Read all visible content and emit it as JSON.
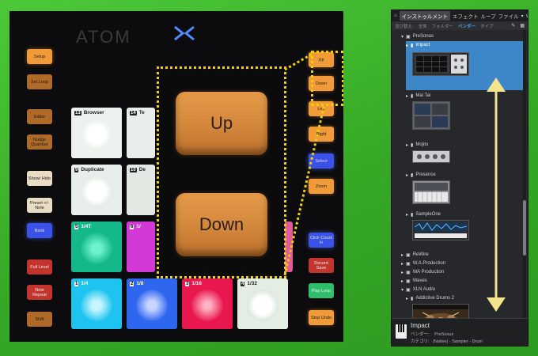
{
  "controller": {
    "logo_text": "ATOM",
    "left_buttons": [
      "Setup",
      "Set Loop",
      "Editor",
      "Nudge Quantize",
      "Show/ Hide",
      "Preset +/- Note",
      "Bank",
      "Full Level",
      "Note Repeat",
      "Shift"
    ],
    "right_buttons": [
      "Up",
      "Down",
      "Left",
      "Right",
      "Select",
      "Zoom",
      "Click Count In",
      "Record Save",
      "Play Loop",
      "Stop Undo"
    ],
    "pads": [
      {
        "num": "13",
        "label": "Browser"
      },
      {
        "num": "14",
        "label": "Te"
      },
      {
        "num": "9",
        "label": "Duplicate"
      },
      {
        "num": "10",
        "label": "De"
      },
      {
        "num": "5",
        "label": "1/4T"
      },
      {
        "num": "6",
        "label": "1/"
      },
      {
        "num": "1",
        "label": "1/4"
      },
      {
        "num": "2",
        "label": "1/8"
      },
      {
        "num": "3",
        "label": "1/16"
      },
      {
        "num": "4",
        "label": "1/32"
      }
    ],
    "zoom_keys": {
      "up": "Up",
      "down": "Down"
    }
  },
  "browser": {
    "tabs": [
      "インストゥルメント",
      "エフェクト",
      "ループ",
      "ファイル"
    ],
    "sort_label": "並び替え:",
    "sort_options": [
      "全体",
      "フォルダー",
      "ベンダー",
      "タイプ"
    ],
    "sort_selected": "ベンダー",
    "vendor": "PreSonus",
    "instruments": [
      "Impact",
      "Mai Tai",
      "Mojito",
      "Presence",
      "SampleOne"
    ],
    "folders": [
      "ReWire",
      "W.A.Production",
      "WA Production",
      "Waves",
      "XLN Audio"
    ],
    "xln_item": "Addictive Drums 2",
    "info": {
      "title": "Impact",
      "vendor_label": "ベンダー:",
      "vendor_value": "PreSonus",
      "category_label": "カテゴリ:",
      "category_value": "(Native) - Sampler - Drum"
    }
  },
  "colors": {
    "background": "#3fb52d",
    "annotation": "#f3d000",
    "selection": "#3d87c9"
  }
}
